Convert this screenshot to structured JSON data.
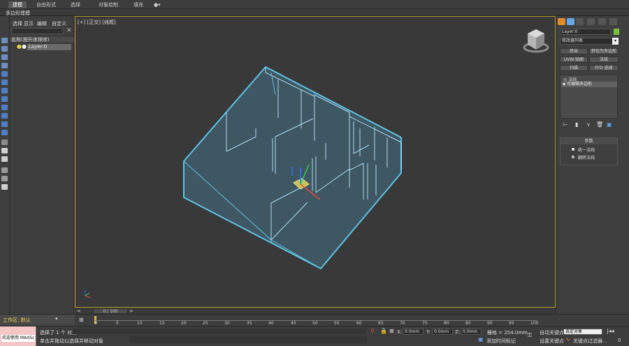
{
  "ribbon": {
    "tabs": [
      "建模",
      "自由形式",
      "选择",
      "对象绘制",
      "填充"
    ],
    "sub_label": "多边形建模"
  },
  "scene_explorer": {
    "menus": [
      "选择",
      "显示",
      "编辑",
      "自定义"
    ],
    "search_placeholder": "",
    "column_header": "名称(按升序排序)",
    "rows": [
      {
        "name": "Layer:0"
      }
    ]
  },
  "viewport": {
    "label": "[+] [正交] [线框]"
  },
  "time_slider": {
    "position": "0 / 100"
  },
  "command_panel": {
    "object_name": "Layer:0",
    "object_color": "#7bbf3d",
    "modifier_list": "修改器列表",
    "buttons": [
      "挤出",
      "转化为多边形",
      "UVW 贴图",
      "法线",
      "扫描",
      "FFD 选择"
    ],
    "stack_items": [
      "法线",
      "可编辑多边形"
    ],
    "rollout_title": "参数",
    "options": [
      {
        "label": "统一法线",
        "checked": false
      },
      {
        "label": "翻转法线",
        "checked": true
      }
    ]
  },
  "workspace": {
    "label": "工作区: 默认"
  },
  "timeline": {
    "ticks": [
      "0",
      "5",
      "10",
      "15",
      "20",
      "25",
      "30",
      "35",
      "40",
      "45",
      "50",
      "55",
      "60",
      "65",
      "70",
      "75",
      "80",
      "85",
      "90",
      "95",
      "100"
    ]
  },
  "status": {
    "maxscript": "欢迎使用 MAXSc",
    "selection_count": "选择了 1 个 对象",
    "prompt": "单击并拖动以选择并移动对象",
    "x_label": "X:",
    "x_value": "0.0mm",
    "y_label": "Y:",
    "y_value": "0.0mm",
    "z_label": "Z:",
    "z_value": "0.0mm",
    "grid": "栅格 = 254.0mm",
    "add_time_tag": "添加时间标记",
    "auto_key": "自动关键点",
    "selected_object": "选定对象",
    "set_key": "设置关键点",
    "key_filters": "关键点过滤器...",
    "frame": "0"
  },
  "colors": {
    "wire": "#5fc3e8",
    "viewport_border": "#b89a2c"
  }
}
